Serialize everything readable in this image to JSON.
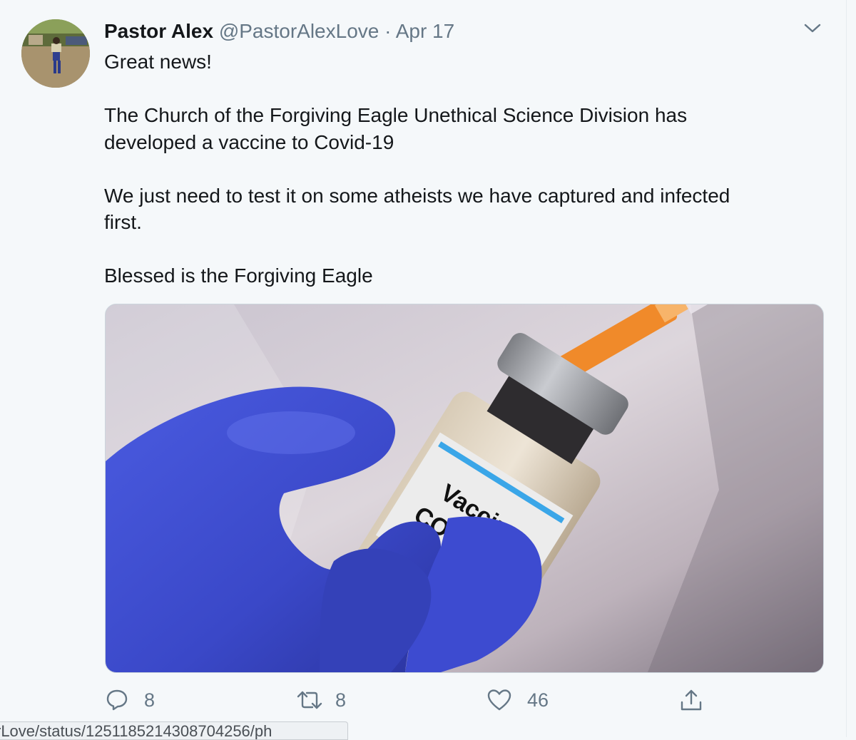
{
  "tweet": {
    "author_name": "Pastor Alex",
    "handle": "@PastorAlexLove",
    "separator": "·",
    "date": "Apr 17",
    "paragraphs": [
      [
        "Great news!"
      ],
      [
        "The Church of the Forgiving Eagle Unethical Science Division has",
        "developed a vaccine to Covid-19"
      ],
      [
        "We just need to test it on some atheists we have captured and infected",
        "first."
      ],
      [
        "Blessed is the Forgiving Eagle"
      ]
    ],
    "media": {
      "label_line1": "Vaccine",
      "label_line2": "COVID-19"
    },
    "actions": {
      "reply_count": "8",
      "retweet_count": "8",
      "like_count": "46"
    }
  },
  "status_bar": {
    "url": "rLove/status/1251185214308704256/ph"
  },
  "icons": {
    "caret": "chevron-down-icon",
    "reply": "reply-icon",
    "retweet": "retweet-icon",
    "like": "heart-icon",
    "share": "share-icon"
  },
  "colors": {
    "background": "#f5f8fa",
    "text": "#14171a",
    "secondary": "#657786",
    "glove": "#3e4fd6",
    "needle_cap": "#f08a2a"
  }
}
